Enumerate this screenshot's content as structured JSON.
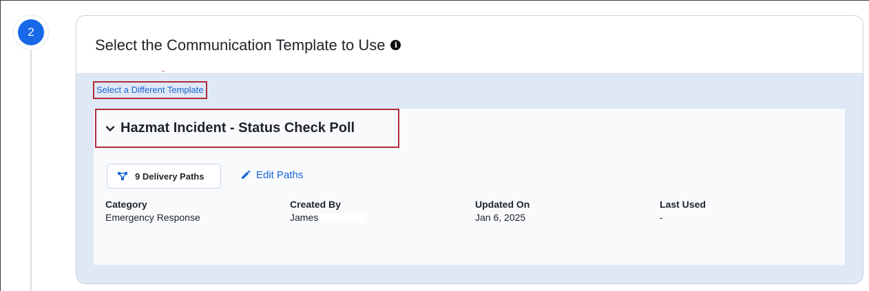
{
  "step": {
    "number": "2"
  },
  "card": {
    "title": "Select the Communication Template to Use",
    "info_icon": "info-icon",
    "select_different_label": "Select a Different Template"
  },
  "template": {
    "title": "Hazmat Incident - Status Check Poll",
    "expanded": true,
    "delivery_paths_label": "9 Delivery Paths",
    "edit_paths_label": "Edit Paths",
    "fields": [
      {
        "label": "Category",
        "value": "Emergency Response"
      },
      {
        "label": "Created By",
        "value": "James"
      },
      {
        "label": "Updated On",
        "value": "Jan 6, 2025"
      },
      {
        "label": "Last Used",
        "value": "-"
      }
    ]
  },
  "colors": {
    "accent": "#1769e8",
    "link": "#1a63d6",
    "highlight_border": "#b02a37",
    "panel_background": "#dfe8f5"
  }
}
